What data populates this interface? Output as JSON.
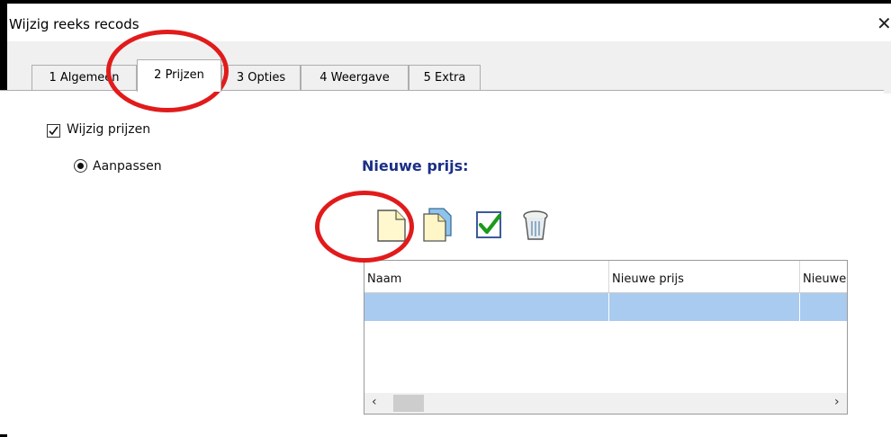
{
  "window": {
    "title": "Wijzig reeks recods",
    "close_glyph": "✕"
  },
  "tabs": [
    {
      "label": "1 Algemeen",
      "active": false
    },
    {
      "label": "2 Prijzen",
      "active": true
    },
    {
      "label": "3 Opties",
      "active": false
    },
    {
      "label": "4 Weergave",
      "active": false
    },
    {
      "label": "5 Extra",
      "active": false
    }
  ],
  "prices": {
    "change_prices_label": "Wijzig prijzen",
    "change_prices_checked": true,
    "adjust_label": "Aanpassen",
    "adjust_selected": true,
    "new_price_label": "Nieuwe prijs:",
    "toolbar": [
      {
        "icon": "new-document-icon"
      },
      {
        "icon": "copy-document-icon"
      },
      {
        "icon": "checkmark-icon"
      },
      {
        "icon": "trash-icon"
      }
    ],
    "table": {
      "columns": [
        "Naam",
        "Nieuwe prijs",
        "Nieuwe"
      ],
      "selected_row_color": "#aacbf0"
    }
  },
  "scrollbar": {
    "left_glyph": "‹",
    "right_glyph": "›"
  },
  "annotation_color": "#e11b1b"
}
